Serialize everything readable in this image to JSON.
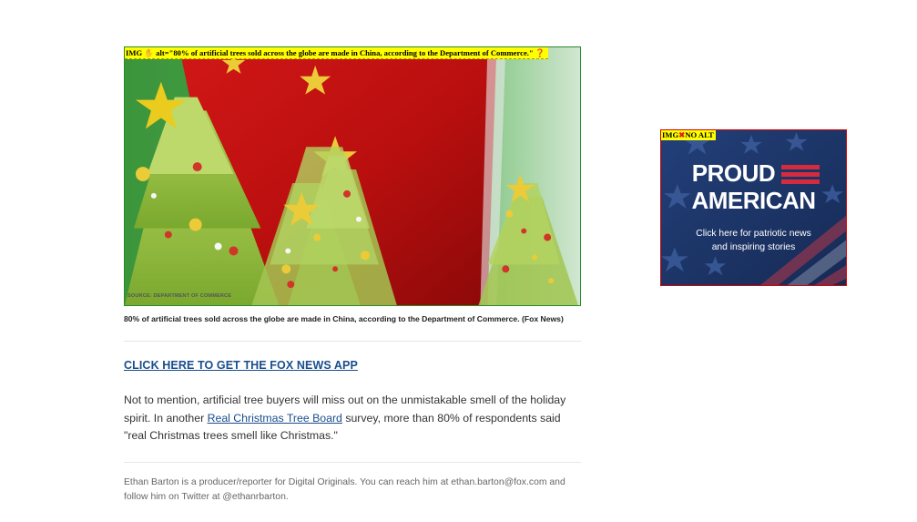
{
  "figure": {
    "alt_badge_prefix": "IMG",
    "alt_text": "alt=\"80% of artificial trees sold across the globe are made in China, according to the Department of Commerce.\"",
    "alt_badge_hand_icon": "hand-icon",
    "alt_badge_question_icon": "question-icon",
    "source_text": "SOURCE: DEPARTMENT OF COMMERCE",
    "caption": "80% of artificial trees sold across the globe are made in China, according to the Department of Commerce. (Fox News)"
  },
  "cta": {
    "label": "CLICK HERE TO GET THE FOX NEWS APP"
  },
  "paragraph": {
    "before_link": "Not to mention, artificial tree buyers will miss out on the unmistakable smell of the holiday spirit. In another ",
    "link_text": "Real Christmas Tree Board",
    "after_link": " survey, more than 80% of respondents said \"real Christmas trees smell like Christmas.\""
  },
  "byline": {
    "text": "Ethan Barton is a producer/reporter for Digital Originals. You can reach him at ethan.barton@fox.com and follow him on Twitter at @ethanrbarton."
  },
  "ad": {
    "badge_prefix": "IMG",
    "badge_text": "NO ALT",
    "badge_icon": "x-icon",
    "title_line1": "PROUD",
    "title_line2": "AMERICAN",
    "subtitle_line1": "Click here for patriotic news",
    "subtitle_line2": "and inspiring stories"
  },
  "colors": {
    "link": "#1a4d8c",
    "alt_badge_bg": "#ffff00",
    "figure_border": "#2b8a2b",
    "ad_border": "#dd0000",
    "ad_bg": "#1d3566",
    "ad_stripe": "#d52b3c"
  }
}
